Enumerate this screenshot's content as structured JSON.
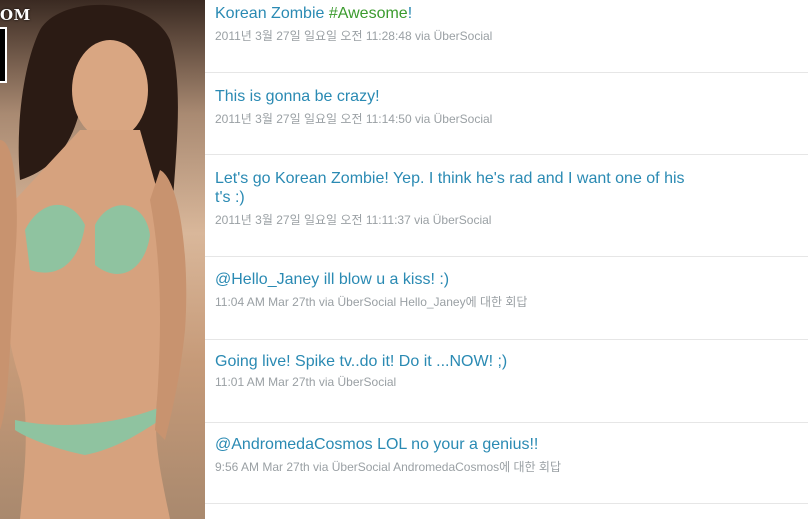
{
  "sidebar": {
    "site_tag": "OM"
  },
  "tweets": [
    {
      "text_plain": "Korean Zombie ",
      "hashtag": "#Awesome",
      "text_tail": "!",
      "meta": "2011년 3월 27일 일요일 오전 11:28:48 via ÜberSocial"
    },
    {
      "text": "This is gonna be crazy!",
      "meta": "2011년 3월 27일 일요일 오전 11:14:50 via ÜberSocial"
    },
    {
      "text_line1": "Let's go Korean Zombie! Yep. I think he's rad and I want one of his",
      "text_line2": "t's :)",
      "meta": "2011년 3월 27일 일요일 오전 11:11:37 via ÜberSocial"
    },
    {
      "mention": "@Hello_Janey",
      "text": " ill blow u a kiss! :)",
      "meta": "11:04 AM Mar 27th via ÜberSocial Hello_Janey에 대한 회답"
    },
    {
      "text": "Going live! Spike tv..do it! Do it ...NOW! ;)",
      "meta": "11:01 AM Mar 27th via ÜberSocial"
    },
    {
      "mention": "@AndromedaCosmos",
      "text": " LOL no your a genius!!",
      "meta": "9:56 AM Mar 27th via ÜberSocial AndromedaCosmos에 대한 회답"
    }
  ],
  "colors": {
    "link": "#2a8ab3",
    "hashtag": "#3b9b2e",
    "meta": "#9aa0a4"
  }
}
